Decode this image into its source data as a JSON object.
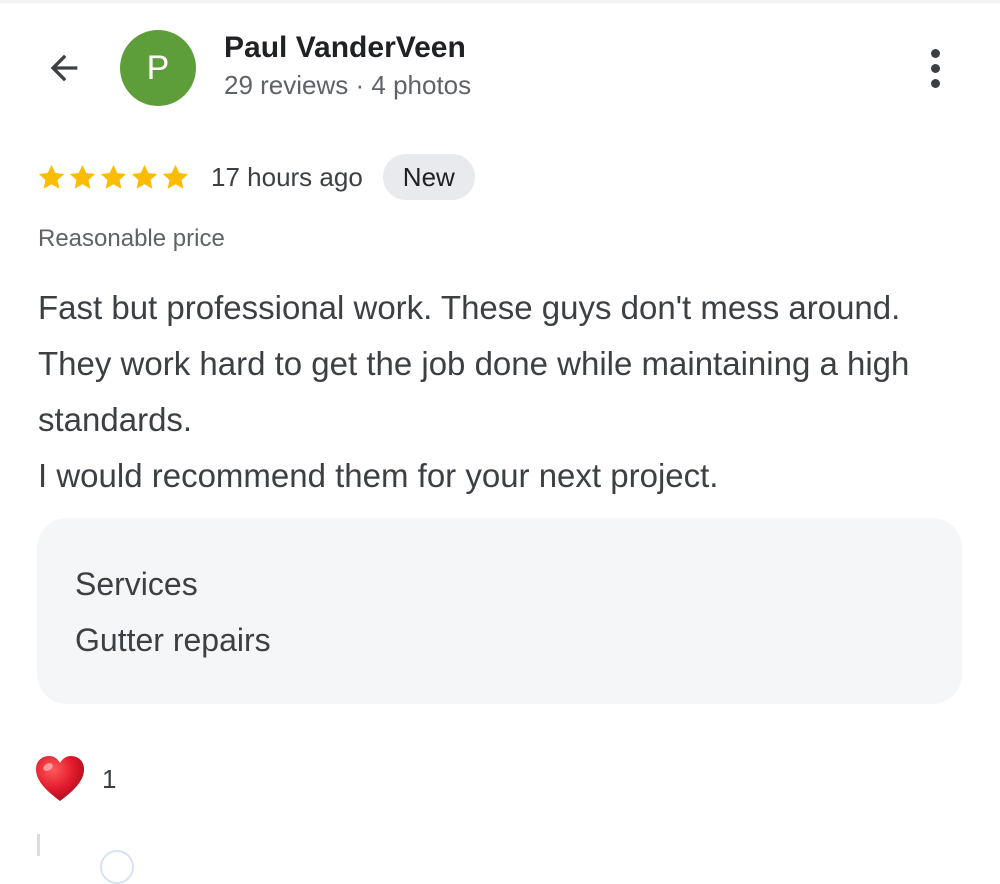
{
  "header": {
    "back_icon": "arrow-left-icon",
    "avatar_letter": "P",
    "avatar_color": "#5d9e3a",
    "reviewer_name": "Paul VanderVeen",
    "reviewer_meta": "29 reviews · 4 photos",
    "menu_icon": "more-vertical-icon"
  },
  "review": {
    "rating": 5,
    "max_rating": 5,
    "star_color": "#fbbc04",
    "time": "17 hours ago",
    "badge": "New",
    "attribute": "Reasonable price",
    "text_paragraph_1": "Fast but professional work. These guys don't mess around. They work hard to get the job done while maintaining a high standards.",
    "text_paragraph_2": "I would recommend them for your next project."
  },
  "services": {
    "title": "Services",
    "value": "Gutter repairs"
  },
  "reactions": {
    "icon": "heart-icon",
    "count": "1"
  }
}
